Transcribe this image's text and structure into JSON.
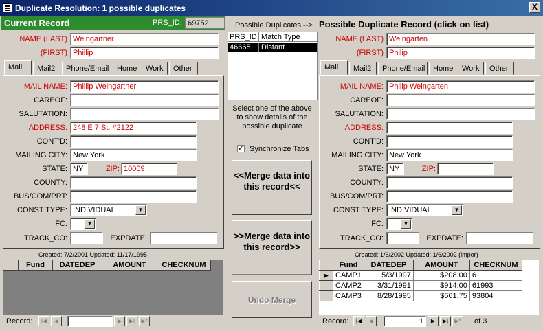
{
  "window": {
    "title": "Duplicate Resolution: 1 possible duplicates",
    "close_label": "X"
  },
  "left": {
    "header": "Current Record",
    "prs_id_label": "PRS_ID:",
    "prs_id": "69752",
    "name_last_label": "NAME (LAST)",
    "name_last": "Weingartner",
    "first_label": "(FIRST)",
    "first": "Phillip",
    "tabs": [
      "Mail",
      "Mail2",
      "Phone/Email",
      "Home",
      "Work",
      "Other"
    ],
    "fields": {
      "mail_name_label": "MAIL NAME:",
      "mail_name": "Phillip Weingartner",
      "careof_label": "CAREOF:",
      "careof": "",
      "salutation_label": "SALUTATION:",
      "salutation": "",
      "address_label": "ADDRESS:",
      "address": "248 E 7 St.  #2122",
      "contd_label": "CONT'D:",
      "contd": "",
      "city_label": "MAILING CITY:",
      "city": "New York",
      "state_label": "STATE:",
      "state": "NY",
      "zip_label": "ZIP:",
      "zip": "10009",
      "county_label": "COUNTY:",
      "county": "",
      "bus_label": "BUS/COM/PRT:",
      "bus": "",
      "const_type_label": "CONST TYPE:",
      "const_type": "INDIVIDUAL",
      "fc_label": "FC:",
      "fc": "",
      "track_label": "TRACK_CO:",
      "track": "",
      "expdate_label": "EXPDATE:",
      "expdate": ""
    },
    "created": "Created:     7/2/2001   Updated: 11/17/1995",
    "grid_headers": [
      "Fund",
      "DATEDEP",
      "AMOUNT",
      "CHECKNUM"
    ],
    "record_label": "Record:"
  },
  "middle": {
    "possible_label": "Possible Duplicates -->",
    "list_headers": [
      "PRS_ID",
      "Match Type"
    ],
    "list_rows": [
      [
        "46665",
        "Distant"
      ]
    ],
    "instruction": "Select one of the above to show details of the possible duplicate",
    "sync_label": "Synchronize Tabs",
    "merge_into_this": "<<Merge data into this record<<",
    "merge_into_other": ">>Merge data into this record>>",
    "undo": "Undo Merge"
  },
  "right": {
    "header": "Possible Duplicate Record (click on list)",
    "name_last_label": "NAME (LAST)",
    "name_last": "Weingarten",
    "first_label": "(FIRST)",
    "first": "Philip",
    "tabs": [
      "Mail",
      "Mail2",
      "Phone/Email",
      "Home",
      "Work",
      "Other"
    ],
    "fields": {
      "mail_name_label": "MAIL NAME:",
      "mail_name": "Philip Weingarten",
      "careof_label": "CAREOF:",
      "careof": "",
      "salutation_label": "SALUTATION:",
      "salutation": "",
      "address_label": "ADDRESS:",
      "address": "",
      "contd_label": "CONT'D:",
      "contd": "",
      "city_label": "MAILING CITY:",
      "city": "New York",
      "state_label": "STATE:",
      "state": "NY",
      "zip_label": "ZIP:",
      "zip": "",
      "county_label": "COUNTY:",
      "county": "",
      "bus_label": "BUS/COM/PRT:",
      "bus": "",
      "const_type_label": "CONST TYPE:",
      "const_type": "INDIVIDUAL",
      "fc_label": "FC:",
      "fc": "",
      "track_label": "TRACK_CO:",
      "track": "",
      "expdate_label": "EXPDATE:",
      "expdate": ""
    },
    "created": "Created:     1/6/2002   Updated: 1/6/2002 (impor)",
    "grid_headers": [
      "Fund",
      "DATEDEP",
      "AMOUNT",
      "CHECKNUM"
    ],
    "grid_rows": [
      [
        "CAMP1",
        "5/3/1997",
        "$208.00",
        "6"
      ],
      [
        "CAMP2",
        "3/31/1991",
        "$914.00",
        "61993"
      ],
      [
        "CAMP3",
        "8/28/1995",
        "$661.75",
        "93804"
      ]
    ],
    "record_label": "Record:",
    "record_current": "1",
    "record_of": "of  3"
  }
}
